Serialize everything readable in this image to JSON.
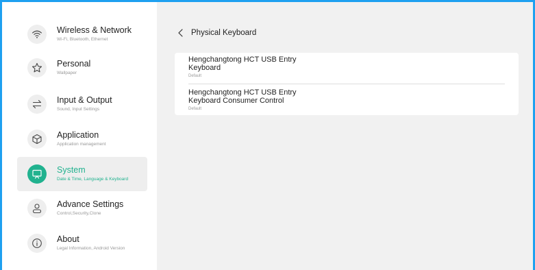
{
  "sidebar": {
    "items": [
      {
        "title": "Wireless & Network",
        "subtitle": "Wi-Fi, Bluetooth, Ethernet",
        "icon": "wifi-icon"
      },
      {
        "title": "Personal",
        "subtitle": "Wallpaper",
        "icon": "star-icon"
      },
      {
        "title": "Input & Output",
        "subtitle": "Sound, Input Settings",
        "icon": "swap-arrows-icon"
      },
      {
        "title": "Application",
        "subtitle": "Application management",
        "icon": "cube-icon"
      },
      {
        "title": "System",
        "subtitle": "Date & Time, Language & Keyboard",
        "icon": "display-icon",
        "active": true
      },
      {
        "title": "Advance Settings",
        "subtitle": "Control,Security,Clone",
        "icon": "user-icon"
      },
      {
        "title": "About",
        "subtitle": "Legal Information, Android Version",
        "icon": "info-icon"
      }
    ]
  },
  "main": {
    "title": "Physical Keyboard",
    "keyboards": [
      {
        "line1": "Hengchangtong  HCT USB Entry",
        "line2": "Keyboard",
        "layout": "Default"
      },
      {
        "line1": "Hengchangtong  HCT USB Entry",
        "line2": "Keyboard Consumer Control",
        "layout": "Default"
      }
    ]
  },
  "colors": {
    "accent": "#21b28f",
    "frame": "#1ea0f0",
    "main_bg": "#f1f1f1",
    "active_bg": "#eeeeee"
  }
}
